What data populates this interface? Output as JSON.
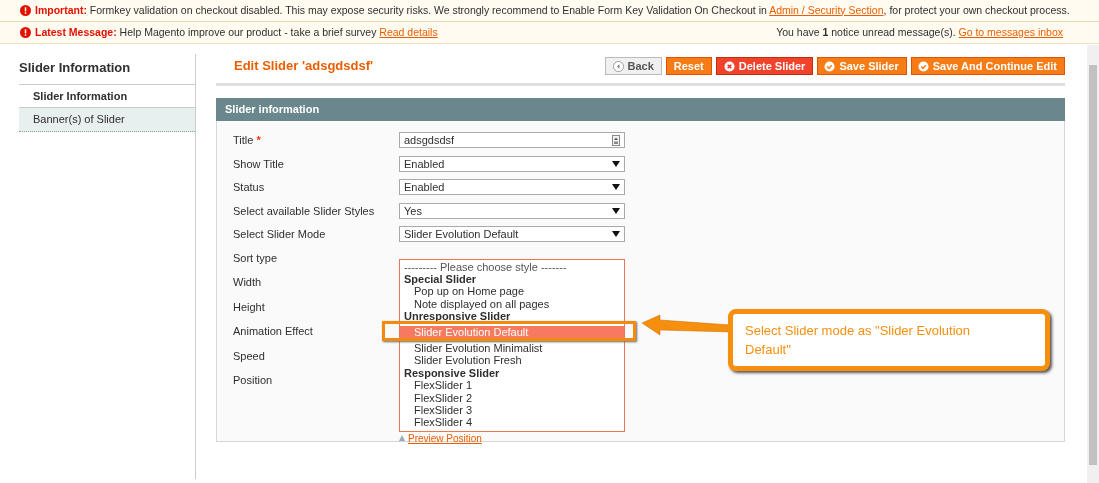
{
  "notices": [
    {
      "kind": "important",
      "label": "Important:",
      "text": "Formkey validation on checkout disabled. This may expose security risks. We strongly recommend to Enable Form Key Validation On Checkout in ",
      "link": "Admin / Security Section",
      "after": ", for protect your own checkout process."
    },
    {
      "kind": "latest",
      "label": "Latest Message:",
      "text": "Help Magento improve our product - take a brief survey ",
      "link": "Read details",
      "right_text": "You have **1** notice unread message(s). ",
      "right_link": "Go to messages inbox"
    }
  ],
  "sidebar": {
    "title": "Slider Information",
    "items": [
      {
        "label": "Slider Information",
        "selected": true
      },
      {
        "label": "Banner(s) of Slider",
        "selected": false
      }
    ]
  },
  "page_title": "Edit Slider 'adsgdsdsf'",
  "buttons": [
    {
      "label": "Back",
      "kind": "back"
    },
    {
      "label": "Reset",
      "kind": "reset"
    },
    {
      "label": "Delete Slider",
      "kind": "delete"
    },
    {
      "label": "Save Slider",
      "kind": "save"
    },
    {
      "label": "Save And Continue Edit",
      "kind": "save"
    }
  ],
  "section_title": "Slider information",
  "fields": [
    {
      "label": "Title",
      "mark": "*",
      "kind": "text",
      "value": "adsgdsdsf"
    },
    {
      "label": "Show Title",
      "kind": "select",
      "value": "Enabled"
    },
    {
      "label": "Status",
      "kind": "select",
      "value": "Enabled"
    },
    {
      "label": "Select available Slider Styles",
      "kind": "select",
      "value": "Yes"
    },
    {
      "label": "Select Slider Mode",
      "kind": "select",
      "value": "Slider Evolution Default"
    },
    {
      "label": "Sort type",
      "kind": "hidden"
    },
    {
      "label": "Width",
      "kind": "hidden"
    },
    {
      "label": "Height",
      "kind": "hidden"
    },
    {
      "label": "Animation Effect",
      "kind": "hidden"
    },
    {
      "label": "Speed",
      "kind": "hidden"
    },
    {
      "label": "Position",
      "kind": "hidden"
    }
  ],
  "dropdown": [
    {
      "label": "--------- Please choose style -------",
      "kind": "placeholder"
    },
    {
      "label": "Special Slider",
      "kind": "group"
    },
    {
      "label": "Pop up on Home page",
      "kind": "option",
      "selected": false
    },
    {
      "label": "Note displayed on all pages",
      "kind": "option",
      "selected": false
    },
    {
      "label": "Unresponsive Slider",
      "kind": "group"
    },
    {
      "label": "Slider Evolution Default",
      "kind": "option",
      "selected": true
    },
    {
      "label": "Slider Evolution Minimalist",
      "kind": "option",
      "selected": false
    },
    {
      "label": "Slider Evolution Fresh",
      "kind": "option",
      "selected": false
    },
    {
      "label": "Responsive Slider",
      "kind": "group"
    },
    {
      "label": "FlexSlider 1",
      "kind": "option",
      "selected": false
    },
    {
      "label": "FlexSlider 2",
      "kind": "option",
      "selected": false
    },
    {
      "label": "FlexSlider 3",
      "kind": "option",
      "selected": false
    },
    {
      "label": "FlexSlider 4",
      "kind": "option",
      "selected": false
    }
  ],
  "preview_link": "Preview Position",
  "callout": "Select Slider mode as \"Slider Evolution Default\""
}
